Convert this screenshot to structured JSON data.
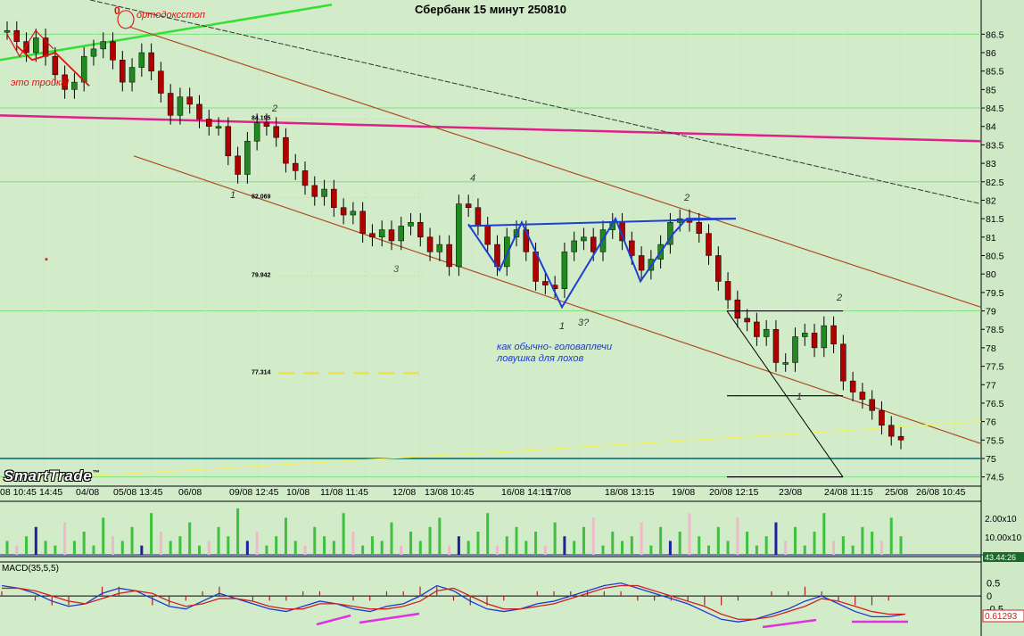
{
  "title": "Сбербанк 15 минут 250810",
  "brand": "SmartTrade",
  "brand_mark": "™",
  "colors": {
    "background": "#d2ecca",
    "candle_up": "#1f8a1f",
    "candle_down": "#b00000",
    "magenta_line": "#e0208a",
    "green_line": "#33e033",
    "brown_channel": "#b04a20",
    "blue_pattern": "#1f3fd0",
    "volume_up": "#3fc03f",
    "volume_down": "#f0b8c8"
  },
  "annotations": {
    "orthodox_stop": "ортодоксстоп",
    "zero_label": "0",
    "troika": "это тройка!",
    "head_shoulders_1": "как обычно- головаплечи",
    "head_shoulders_2": "ловушка для лохов",
    "wave_labels": [
      "2",
      "1",
      "3",
      "4",
      "1",
      "3?",
      "2",
      "2",
      "1"
    ],
    "fib_levels": [
      "84.195",
      "82.069",
      "79.942",
      "77.314"
    ]
  },
  "chart_data": [
    {
      "type": "line",
      "title": "Сбербанк 15 минут 250810",
      "ylim": [
        74.25,
        86.75
      ],
      "price_axis_ticks": [
        "86.5",
        "86",
        "85.5",
        "85",
        "84.5",
        "84",
        "83.5",
        "83",
        "82.5",
        "82",
        "81.5",
        "81",
        "80.5",
        "80",
        "79.5",
        "79",
        "78.5",
        "78",
        "77.5",
        "77",
        "76.5",
        "76",
        "75.5",
        "75",
        "74.5"
      ],
      "x_ticks": [
        "08 10:45",
        "14:45",
        "04/08",
        "05/08 13:45",
        "06/08",
        "09/08 12:45",
        "10/08",
        "11/08 11:45",
        "12/08",
        "13/08 10:45",
        "16/08 14:15",
        "17/08",
        "18/08 13:15",
        "19/08",
        "20/08 12:15",
        "23/08",
        "24/08 11:15",
        "25/08",
        "26/08 10:45"
      ],
      "series": [
        {
          "values": [
            86.6,
            86.3,
            86.0,
            86.4,
            85.9,
            85.4,
            85.0,
            85.2,
            85.9,
            86.1,
            86.3,
            85.8,
            85.2,
            85.6,
            86.0,
            85.5,
            84.9,
            84.3,
            84.8,
            84.6,
            84.2,
            84.0,
            84.0,
            83.2,
            82.7,
            83.6,
            84.1,
            84.0,
            83.7,
            83.0,
            82.8,
            82.4,
            82.1,
            82.3,
            81.8,
            81.6,
            81.7,
            81.1,
            81.0,
            81.2,
            80.9,
            81.3,
            81.4,
            81.0,
            80.6,
            80.8,
            80.2,
            81.9,
            81.8,
            81.3,
            80.8,
            80.2,
            81.0,
            81.2,
            80.6,
            79.8,
            79.7,
            79.6,
            80.6,
            80.9,
            81.0,
            80.6,
            81.2,
            81.4,
            80.9,
            80.5,
            80.1,
            80.4,
            80.8,
            81.4,
            81.5,
            81.4,
            81.1,
            80.5,
            79.8,
            79.3,
            78.8,
            78.7,
            78.3,
            78.5,
            77.6,
            77.6,
            78.3,
            78.4,
            78.0,
            78.6,
            78.1,
            77.1,
            76.8,
            76.6,
            76.3,
            75.9,
            75.6,
            75.5
          ]
        }
      ]
    },
    {
      "type": "bar",
      "title": "",
      "axis_ticks": [
        "2.00x10",
        "10.00x10"
      ],
      "last_value_label": "43.44:26",
      "values": [
        3,
        2,
        4,
        6,
        3,
        2,
        7,
        3,
        5,
        2,
        8,
        4,
        3,
        6,
        2,
        9,
        5,
        3,
        4,
        7,
        2,
        3,
        6,
        4,
        10,
        3,
        5,
        2,
        4,
        8,
        3,
        2,
        6,
        4,
        3,
        9,
        5,
        2,
        4,
        3,
        7,
        2,
        5,
        3,
        6,
        8,
        2,
        4,
        3,
        5,
        9,
        2,
        4,
        6,
        3,
        5,
        2,
        7,
        4,
        3,
        6,
        8,
        2,
        5,
        3,
        4,
        7,
        2,
        6,
        3,
        5,
        9,
        4,
        2,
        6,
        3,
        8,
        5,
        2,
        4,
        7,
        3,
        6,
        2,
        5,
        9,
        3,
        4,
        2,
        6,
        5,
        3,
        8,
        4
      ]
    },
    {
      "type": "line",
      "title": "MACD(35,5,5)",
      "axis_ticks": [
        "0.5",
        "0",
        "-0.5"
      ],
      "last_value_label": "0.61293",
      "series": [
        {
          "values": [
            0.4,
            0.3,
            0.1,
            -0.2,
            -0.4,
            -0.3,
            0.1,
            0.3,
            0.2,
            -0.1,
            -0.4,
            -0.5,
            -0.2,
            0.1,
            -0.1,
            -0.3,
            -0.5,
            -0.6,
            -0.4,
            -0.2,
            -0.3,
            -0.5,
            -0.6,
            -0.4,
            -0.3,
            0.0,
            0.4,
            0.2,
            -0.2,
            -0.5,
            -0.6,
            -0.5,
            -0.3,
            -0.2,
            0.0,
            0.2,
            0.4,
            0.5,
            0.3,
            0.1,
            -0.1,
            -0.3,
            -0.6,
            -0.9,
            -1.0,
            -0.9,
            -0.7,
            -0.5,
            -0.2,
            0.0,
            -0.3,
            -0.6,
            -0.8,
            -0.8,
            -0.7
          ]
        },
        {
          "values": [
            0.3,
            0.3,
            0.2,
            0.0,
            -0.2,
            -0.3,
            -0.1,
            0.1,
            0.2,
            0.1,
            -0.2,
            -0.4,
            -0.3,
            -0.1,
            -0.1,
            -0.2,
            -0.4,
            -0.5,
            -0.5,
            -0.3,
            -0.3,
            -0.4,
            -0.5,
            -0.5,
            -0.4,
            -0.2,
            0.2,
            0.3,
            0.0,
            -0.3,
            -0.5,
            -0.5,
            -0.4,
            -0.3,
            -0.1,
            0.1,
            0.3,
            0.4,
            0.4,
            0.2,
            0.0,
            -0.2,
            -0.4,
            -0.7,
            -0.9,
            -0.9,
            -0.8,
            -0.6,
            -0.4,
            -0.1,
            -0.2,
            -0.4,
            -0.6,
            -0.7,
            -0.7
          ]
        }
      ]
    }
  ]
}
